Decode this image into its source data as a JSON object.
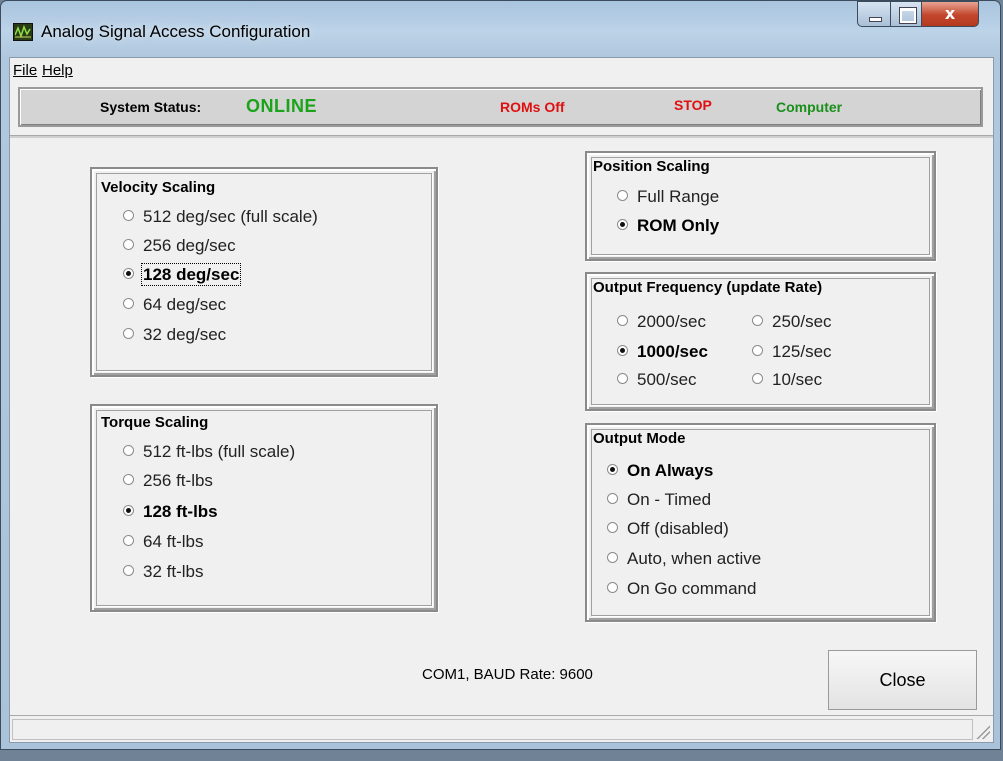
{
  "window": {
    "title": "Analog Signal Access Configuration",
    "close_glyph": "x"
  },
  "menu": {
    "file": "File",
    "help": "Help"
  },
  "status": {
    "label": "System Status:",
    "state": "ONLINE",
    "roms": "ROMs Off",
    "run": "STOP",
    "control": "Computer",
    "colors": {
      "online": "#1ba31b",
      "alert": "#e01010",
      "control": "#1b8f1b"
    }
  },
  "velocity": {
    "title": "Velocity Scaling",
    "options": [
      "512 deg/sec (full scale)",
      "256 deg/sec",
      "128 deg/sec",
      "64 deg/sec",
      "32 deg/sec"
    ],
    "selected": "128 deg/sec"
  },
  "torque": {
    "title": "Torque Scaling",
    "options": [
      "512 ft-lbs (full scale)",
      "256 ft-lbs",
      "128 ft-lbs",
      "64 ft-lbs",
      "32 ft-lbs"
    ],
    "selected": "128 ft-lbs"
  },
  "position": {
    "title": "Position Scaling",
    "options": [
      "Full Range",
      "ROM Only"
    ],
    "selected": "ROM Only"
  },
  "frequency": {
    "title": "Output Frequency (update Rate)",
    "options": [
      "2000/sec",
      "250/sec",
      "1000/sec",
      "125/sec",
      "500/sec",
      "10/sec"
    ],
    "selected": "1000/sec"
  },
  "mode": {
    "title": "Output Mode",
    "options": [
      "On Always",
      "On - Timed",
      "Off (disabled)",
      "Auto, when active",
      "On Go command"
    ],
    "selected": "On Always"
  },
  "footer": {
    "com": "COM1,  BAUD Rate: 9600",
    "close": "Close"
  }
}
